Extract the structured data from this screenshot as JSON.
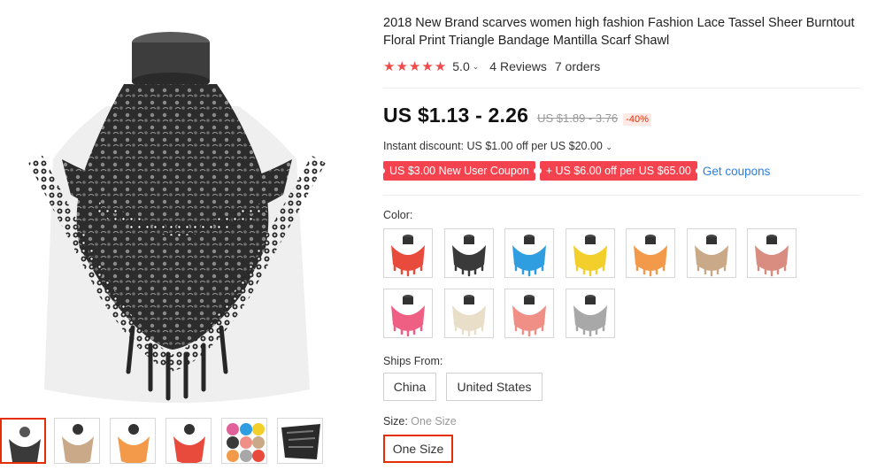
{
  "product": {
    "title": "2018 New Brand scarves women high fashion Fashion Lace Tassel Sheer Burntout Floral Print Triangle Bandage Mantilla Scarf Shawl",
    "rating_score": "5.0",
    "reviews": "4 Reviews",
    "orders": "7 orders",
    "price": "US $1.13 - 2.26",
    "old_price": "US $1.89 - 3.76",
    "discount": "-40%",
    "instant_discount": "Instant discount: US $1.00 off per US $20.00",
    "coupons": [
      "US $3.00 New User Coupon",
      "+ US $6.00 off per US $65.00"
    ],
    "get_coupons": "Get coupons"
  },
  "colors": {
    "label": "Color:",
    "swatches": [
      {
        "name": "red",
        "color": "#e84a3c"
      },
      {
        "name": "black",
        "color": "#3a3a3a"
      },
      {
        "name": "blue",
        "color": "#2f9ee0"
      },
      {
        "name": "yellow",
        "color": "#f2cf2a"
      },
      {
        "name": "orange",
        "color": "#f29a4a"
      },
      {
        "name": "khaki",
        "color": "#c9a987"
      },
      {
        "name": "coral",
        "color": "#d98d80"
      },
      {
        "name": "rose",
        "color": "#ef5f84"
      },
      {
        "name": "beige",
        "color": "#e9dfc8"
      },
      {
        "name": "salmon",
        "color": "#ef8f86"
      },
      {
        "name": "gray",
        "color": "#a8a8a8"
      }
    ]
  },
  "shipping": {
    "label": "Ships From:",
    "options": [
      "China",
      "United States"
    ]
  },
  "size": {
    "label": "Size:",
    "selected_hint": "One Size",
    "options": [
      "One Size"
    ]
  },
  "gallery": {
    "thumb_colors": [
      "#3a3a3a",
      "#c9a987",
      "#f29a4a",
      "#e84a3c",
      "#e0609a",
      "#2a2a2a"
    ]
  },
  "theme": {
    "accent": "#e62e04",
    "star": "#f04a4a",
    "coupon_bg": "#f4434e",
    "link": "#2c7fd9"
  }
}
